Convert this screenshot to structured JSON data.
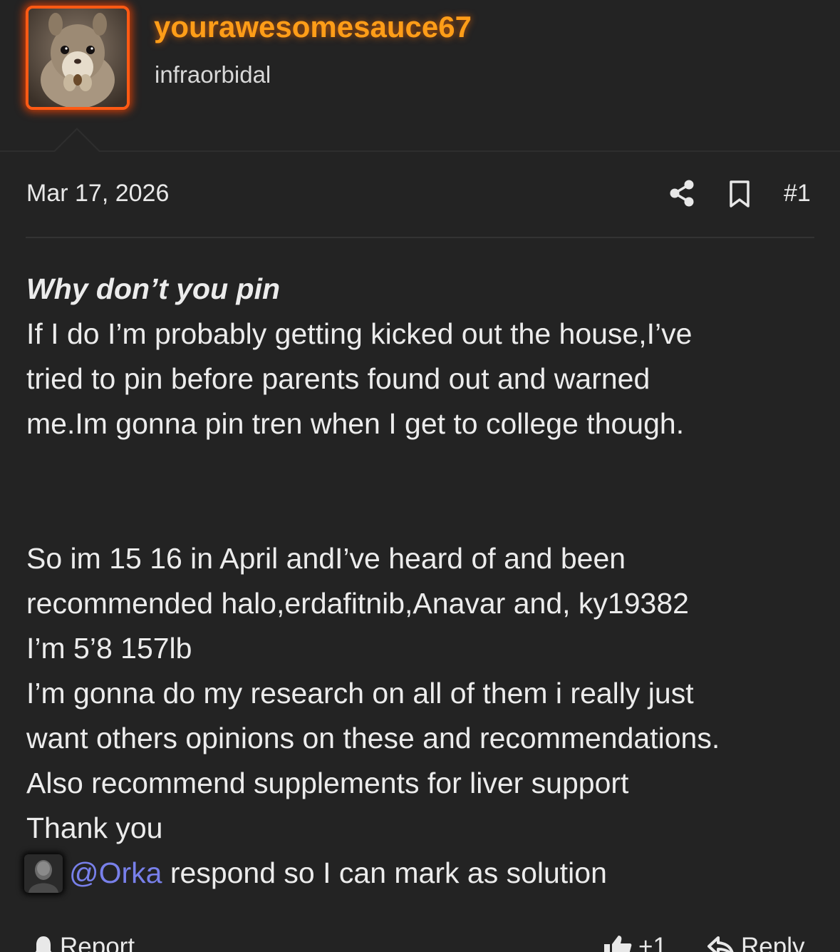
{
  "user": {
    "name": "yourawesomesauce67",
    "title": "infraorbidal",
    "avatar_icon": "squirrel-avatar",
    "accent_color": "#ff9d18",
    "frame_color": "#ff5a14"
  },
  "post": {
    "date": "Mar 17, 2026",
    "number": "#1",
    "share_icon": "share-icon",
    "bookmark_icon": "bookmark-icon",
    "quote_title": "Why don’t you pin",
    "quote_lines": [
      "If I do I’m probably getting kicked out the house,I’ve",
      "tried to pin before parents found out and warned",
      "me.Im gonna pin tren when I get to college though."
    ],
    "body_lines": [
      "So im 15 16 in April andI’ve heard of and been",
      "recommended halo,erdafitnib,Anavar and, ky19382",
      "I’m 5’8 157lb",
      "I’m gonna do my research on all of them i really just",
      "want others opinions on these and recommendations.",
      "Also recommend supplements for liver support",
      "Thank you"
    ],
    "mention": {
      "handle": "@Orka",
      "text": " respond so I can mark as solution",
      "color": "#7880ea"
    }
  },
  "actions": {
    "report_label": "Report",
    "like_label": "+1",
    "reply_label": "Reply"
  }
}
